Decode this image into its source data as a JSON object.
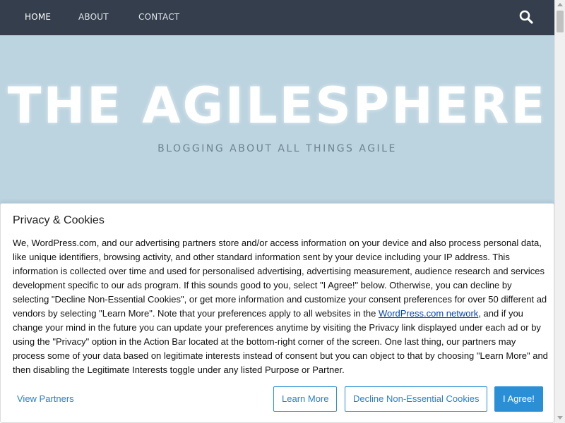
{
  "nav": {
    "items": [
      {
        "label": "HOME",
        "active": true
      },
      {
        "label": "ABOUT",
        "active": false
      },
      {
        "label": "CONTACT",
        "active": false
      }
    ],
    "search_icon": "search-icon"
  },
  "hero": {
    "title": "THE AGILESPHERE",
    "tagline": "BLOGGING ABOUT ALL THINGS AGILE"
  },
  "cookie_notice": {
    "title": "Privacy & Cookies",
    "body_before_link": "We, WordPress.com, and our advertising partners store and/or access information on your device and also process personal data, like unique identifiers, browsing activity, and other standard information sent by your device including your IP address. This information is collected over time and used for personalised advertising, advertising measurement, audience research and services development specific to our ads program. If this sounds good to you, select \"I Agree!\" below. Otherwise, you can decline by selecting \"Decline Non-Essential Cookies\", or get more information and customize your consent preferences for over 50 different ad vendors by selecting \"Learn More\". Note that your preferences apply to all websites in the ",
    "link_text": "WordPress.com network",
    "body_after_link": ", and if you change your mind in the future you can update your preferences anytime by visiting the Privacy link displayed under each ad or by using the \"Privacy\" option in the Action Bar located at the bottom-right corner of the screen. One last thing, our partners may process some of your data based on legitimate interests instead of consent but you can object to that by choosing \"Learn More\" and then disabling the Legitimate Interests toggle under any listed Purpose or Partner.",
    "buttons": {
      "view_partners": "View Partners",
      "learn_more": "Learn More",
      "decline": "Decline Non-Essential Cookies",
      "agree": "I Agree!"
    }
  },
  "colors": {
    "nav_bg": "#343e4c",
    "hero_bg": "#bcd4e0",
    "accent": "#2b8fd6",
    "link": "#0645ad"
  }
}
